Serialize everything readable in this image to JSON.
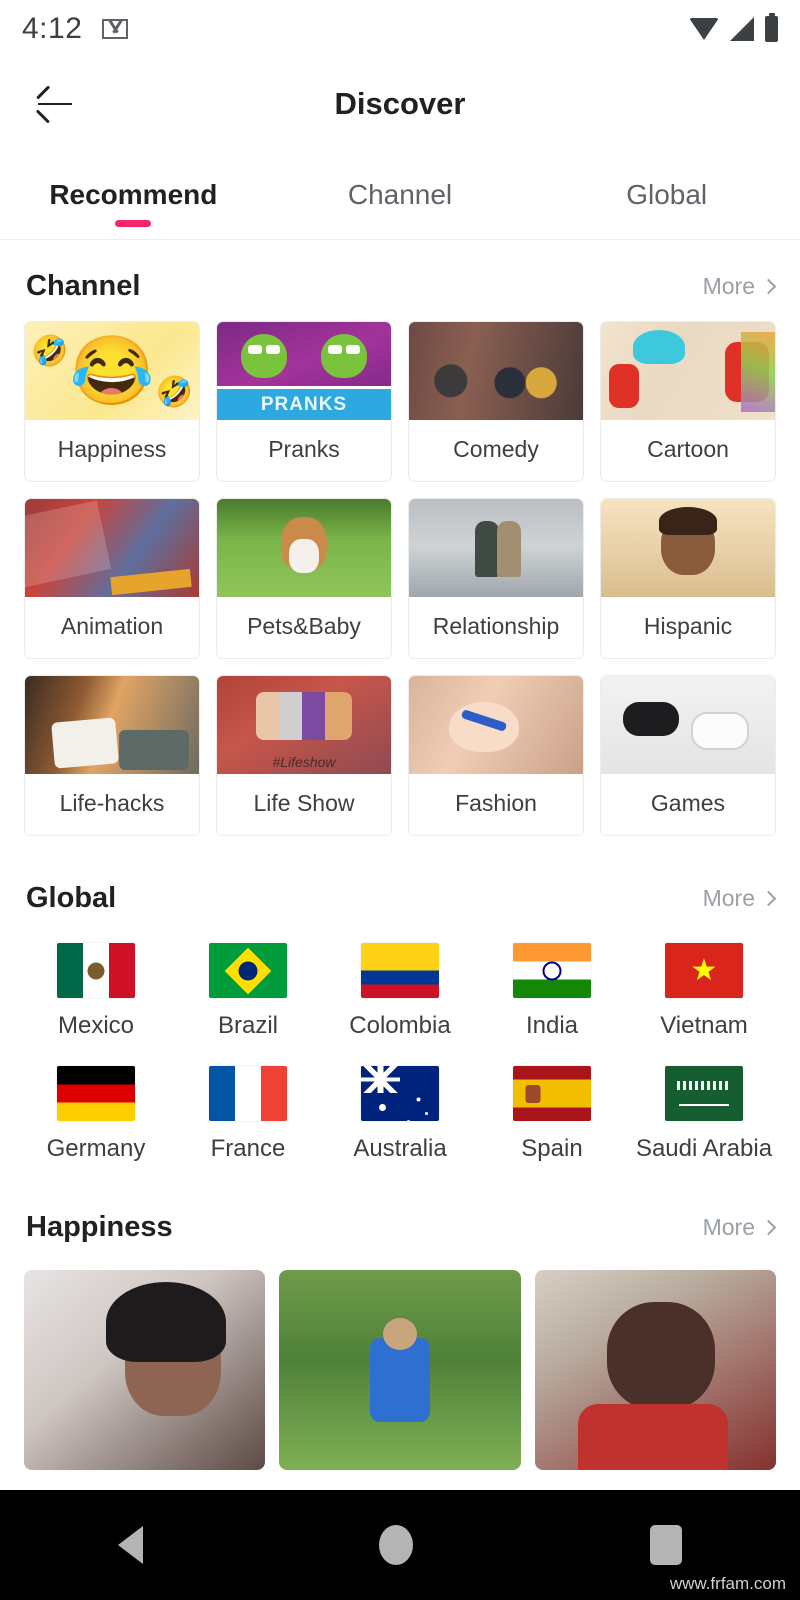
{
  "status_bar": {
    "time": "4:12",
    "icons": [
      "gmail-icon",
      "wifi-icon",
      "signal-icon",
      "battery-icon"
    ]
  },
  "app_bar": {
    "back_icon": "back-arrow-icon",
    "title": "Discover"
  },
  "tabs": [
    {
      "label": "Recommend",
      "active": true
    },
    {
      "label": "Channel",
      "active": false
    },
    {
      "label": "Global",
      "active": false
    }
  ],
  "accent_color": "#f5276c",
  "sections": {
    "channel": {
      "title": "Channel",
      "more_label": "More",
      "items": [
        {
          "name": "Happiness",
          "thumb": "laughing-emoji"
        },
        {
          "name": "Pranks",
          "thumb": "green-creatures-banner"
        },
        {
          "name": "Comedy",
          "thumb": "people-photo"
        },
        {
          "name": "Cartoon",
          "thumb": "thing-one-two-illustration"
        },
        {
          "name": "Animation",
          "thumb": "anime-posters"
        },
        {
          "name": "Pets&Baby",
          "thumb": "corgi-on-grass"
        },
        {
          "name": "Relationship",
          "thumb": "couple-holding-hands"
        },
        {
          "name": "Hispanic",
          "thumb": "smiling-child"
        },
        {
          "name": "Life-hacks",
          "thumb": "cozy-bedroom"
        },
        {
          "name": "Life Show",
          "thumb": "friends-illustration"
        },
        {
          "name": "Fashion",
          "thumb": "makeup-application"
        },
        {
          "name": "Games",
          "thumb": "game-controllers"
        }
      ],
      "lifeshow_caption": "#Lifeshow",
      "pranks_banner": "PRANKS"
    },
    "global": {
      "title": "Global",
      "more_label": "More",
      "countries": [
        {
          "name": "Mexico",
          "flag": "flag-mexico"
        },
        {
          "name": "Brazil",
          "flag": "flag-brazil"
        },
        {
          "name": "Colombia",
          "flag": "flag-colombia"
        },
        {
          "name": "India",
          "flag": "flag-india"
        },
        {
          "name": "Vietnam",
          "flag": "flag-vietnam"
        },
        {
          "name": "Germany",
          "flag": "flag-germany"
        },
        {
          "name": "France",
          "flag": "flag-france"
        },
        {
          "name": "Australia",
          "flag": "flag-australia"
        },
        {
          "name": "Spain",
          "flag": "flag-spain"
        },
        {
          "name": "Saudi Arabia",
          "flag": "flag-saudi-arabia"
        }
      ]
    },
    "happiness": {
      "title": "Happiness",
      "more_label": "More",
      "videos": [
        {
          "thumb": "woman-closeup-video"
        },
        {
          "thumb": "person-outdoors-video"
        },
        {
          "thumb": "man-in-store-video"
        }
      ]
    }
  },
  "nav_bar": {
    "back_icon": "nav-back-triangle-icon",
    "home_icon": "nav-home-circle-icon",
    "recents_icon": "nav-recents-square-icon",
    "watermark": "www.frfam.com"
  },
  "emoji": {
    "laugh": "😂",
    "laugh_small": "🤣",
    "star": "★"
  }
}
